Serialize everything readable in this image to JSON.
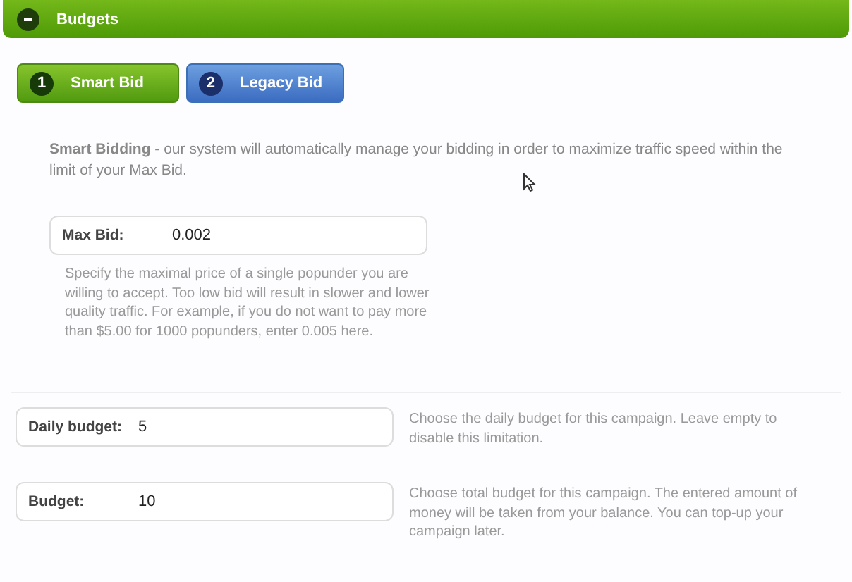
{
  "section": {
    "title": "Budgets",
    "expanded": true
  },
  "tabs": [
    {
      "number": "1",
      "label": "Smart Bid",
      "selected": true
    },
    {
      "number": "2",
      "label": "Legacy Bid",
      "selected": false
    }
  ],
  "intro": "**Smart Bidding** - our system will automatically manage your bidding in order to maximize traffic speed within the limit of your Max Bid.",
  "max_bid": {
    "label": "Max Bid:",
    "value": "0.002",
    "help": "Specify the maximal price of a single popunder you are willing to accept. Too low bid will result in slower and lower quality traffic. For example, if you do not want to pay more than $5.00 for 1000 popunders, enter 0.005 here."
  },
  "fields": [
    {
      "label": "Daily budget:",
      "value": "5",
      "help": "Choose the daily budget for this campaign. Leave empty to disable this limitation."
    },
    {
      "label": "Budget:",
      "value": "10",
      "help": "Choose total budget for this campaign. The entered amount of money will be taken from your balance. You can top-up your campaign later."
    }
  ]
}
